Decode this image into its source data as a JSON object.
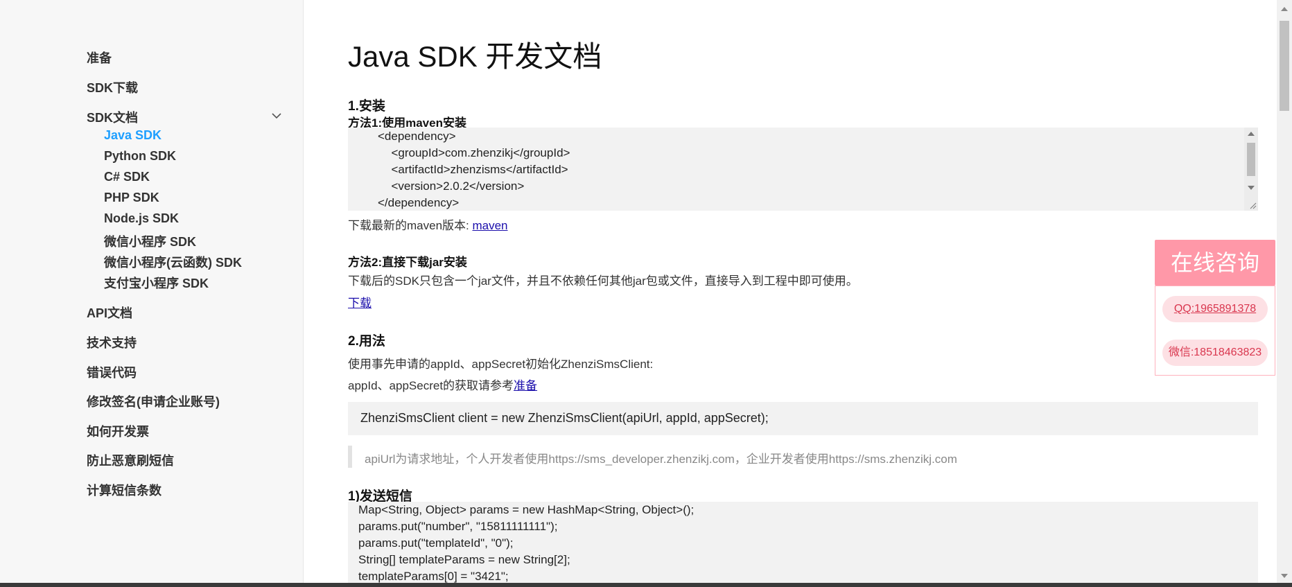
{
  "sidebar": {
    "items": [
      {
        "label": "准备"
      },
      {
        "label": "SDK下载"
      },
      {
        "label": "SDK文档"
      },
      {
        "label": "API文档"
      },
      {
        "label": "技术支持"
      },
      {
        "label": "错误代码"
      },
      {
        "label": "修改签名(申请企业账号)"
      },
      {
        "label": "如何开发票"
      },
      {
        "label": "防止恶意刷短信"
      },
      {
        "label": "计算短信条数"
      }
    ],
    "sdk_docs": [
      {
        "label": "Java SDK"
      },
      {
        "label": "Python SDK"
      },
      {
        "label": "C# SDK"
      },
      {
        "label": "PHP SDK"
      },
      {
        "label": "Node.js SDK"
      },
      {
        "label": "微信小程序 SDK"
      },
      {
        "label": "微信小程序(云函数) SDK"
      },
      {
        "label": "支付宝小程序 SDK"
      }
    ]
  },
  "main": {
    "title": "Java SDK 开发文档",
    "install": {
      "heading": "1.安装",
      "method1": "方法1:使用maven安装",
      "code": [
        "<dependency>",
        "  <groupId>com.zhenzikj</groupId>",
        "  <artifactId>zhenzisms</artifactId>",
        "  <version>2.0.2</version>",
        "</dependency>"
      ],
      "maven_prefix": "下载最新的maven版本: ",
      "maven_link": "maven",
      "method2": "方法2:直接下载jar安装",
      "method2_desc": "下载后的SDK只包含一个jar文件，并且不依赖任何其他jar包或文件，直接导入到工程中即可使用。",
      "download_link": "下载"
    },
    "usage": {
      "heading": "2.用法",
      "line1": "使用事先申请的appId、appSecret初始化ZhenziSmsClient:",
      "line2_prefix": "appId、appSecret的获取请参考",
      "line2_link": "准备",
      "client_code": "ZhenziSmsClient client = new ZhenziSmsClient(apiUrl, appId, appSecret);",
      "note": "apiUrl为请求地址，个人开发者使用https://sms_developer.zhenzikj.com，企业开发者使用https://sms.zhenzikj.com"
    },
    "send": {
      "heading": "1)发送短信",
      "code": [
        "Map<String, Object> params = new HashMap<String, Object>();",
        "params.put(\"number\", \"15811111111\");",
        "params.put(\"templateId\", \"0\");",
        "String[] templateParams = new String[2];",
        "templateParams[0] = \"3421\";"
      ]
    }
  },
  "consult": {
    "title": "在线咨询",
    "qq": "QQ:1965891378",
    "wechat": "微信:18518463823"
  },
  "colors": {
    "active": "#1e9fff",
    "consult": "#ff98a8",
    "link": "#1a0dab"
  }
}
